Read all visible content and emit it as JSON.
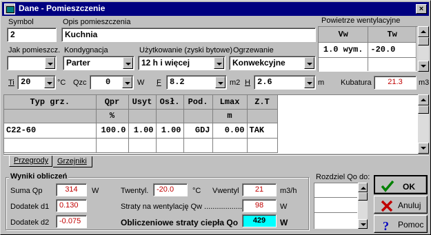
{
  "window": {
    "title": "Dane - Pomieszczenie",
    "close_label": "×"
  },
  "symbol": {
    "label": "Symbol",
    "value": "2"
  },
  "opis": {
    "label": "Opis pomieszczenia",
    "value": "Kuchnia"
  },
  "jak": {
    "label": "Jak pomieszcz.",
    "value": ""
  },
  "kondygnacja": {
    "label": "Kondygnacja",
    "value": "Parter"
  },
  "uzytkowanie": {
    "label": "Użytkowanie (zyski bytowe)",
    "value": "12 h i więcej"
  },
  "ogrzewanie": {
    "label": "Ogrzewanie",
    "value": "Konwekcyjne"
  },
  "vent": {
    "title": "Powietrze wentylacyjne",
    "headers": [
      "Vw",
      "Tw"
    ],
    "row": [
      "1.0 wym.",
      "-20.0"
    ]
  },
  "params": {
    "ti_label": "Ti",
    "ti_value": "20",
    "ti_unit": "°C",
    "qzc_label": "Qzc",
    "qzc_value": "0",
    "qzc_unit": "W",
    "f_label": "F",
    "f_value": "8.2",
    "f_unit": "m2",
    "h_label": "H",
    "h_value": "2.6",
    "h_unit": "m",
    "kubatura_label": "Kubatura",
    "kubatura_value": "21.3",
    "kubatura_unit": "m3"
  },
  "table": {
    "headers": [
      "Typ grz.",
      "Qpr",
      "Usyt",
      "Osł.",
      "Pod.",
      "Lmax",
      "Z.T"
    ],
    "units": [
      "",
      "%",
      "",
      "",
      "",
      "m",
      ""
    ],
    "rows": [
      [
        "C22-60",
        "100.0",
        "1.00",
        "1.00",
        "GDJ",
        "0.00",
        "TAK"
      ]
    ]
  },
  "tabs": [
    "Przegrody",
    "Grzejniki"
  ],
  "results": {
    "title": "Wyniki obliczeń",
    "suma_label": "Suma Qp",
    "suma_value": "314",
    "suma_unit": "W",
    "d1_label": "Dodatek d1",
    "d1_value": "0.130",
    "d2_label": "Dodatek d2",
    "d2_value": "-0.075",
    "twentyl_label": "Twentyl.",
    "twentyl_value": "-20.0",
    "twentyl_unit": "°C",
    "vwentyl_label": "Vwentyl",
    "vwentyl_value": "21",
    "vwentyl_unit": "m3/h",
    "straty_label": "Straty na wentylację Qw .....................",
    "straty_value": "98",
    "straty_unit": "W",
    "oblicz_label": "Obliczeniowe straty ciepła Qo",
    "oblicz_value": "429",
    "oblicz_unit": "W"
  },
  "rozdziel": {
    "label": "Rozdziel Qo do:"
  },
  "buttons": {
    "ok": "OK",
    "anuluj": "Anuluj",
    "pomoc": "Pomoc"
  },
  "colors": {
    "title_bar": "#000080",
    "highlight": "#00ffff",
    "red_value": "#c00000"
  }
}
